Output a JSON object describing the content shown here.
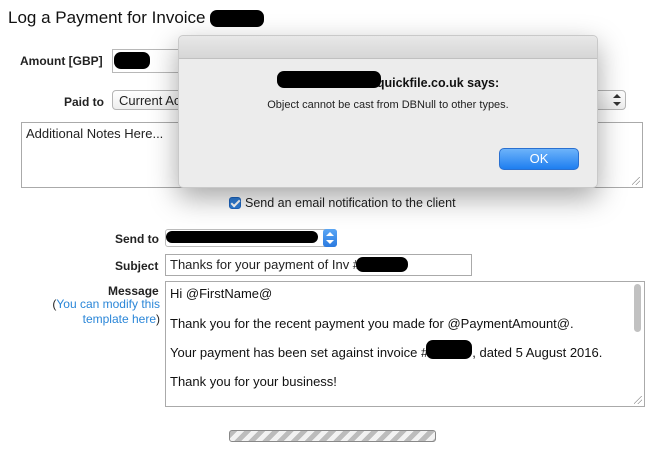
{
  "page": {
    "title": "Log a Payment for Invoice #"
  },
  "form": {
    "amount_label": "Amount [GBP]",
    "paid_to_label": "Paid to",
    "paid_to_value": "Current Ac",
    "notes_placeholder": "Additional Notes Here...",
    "email_checkbox_label": "Send an email notification to the client",
    "email_checkbox_checked": true,
    "send_to_label": "Send to",
    "subject_label": "Subject",
    "subject_value": "Thanks for your payment of Inv #",
    "message_label": "Message",
    "message_link_open": "(",
    "message_link_text": "You can modify this template here",
    "message_link_close": ")",
    "message_lines": [
      "Hi @FirstName@",
      "Thank you for the recent payment you made for @PaymentAmount@.",
      "Your payment has been set against invoice #",
      ", dated 5 August 2016.",
      "Thank you for your business!"
    ]
  },
  "dialog": {
    "title_suffix": "quickfile.co.uk says:",
    "message": "Object cannot be cast from DBNull to other types.",
    "ok_label": "OK"
  },
  "colors": {
    "accent": "#2a86d8",
    "ok_button": "#1e7ef0",
    "checkbox": "#2f7ed8"
  }
}
